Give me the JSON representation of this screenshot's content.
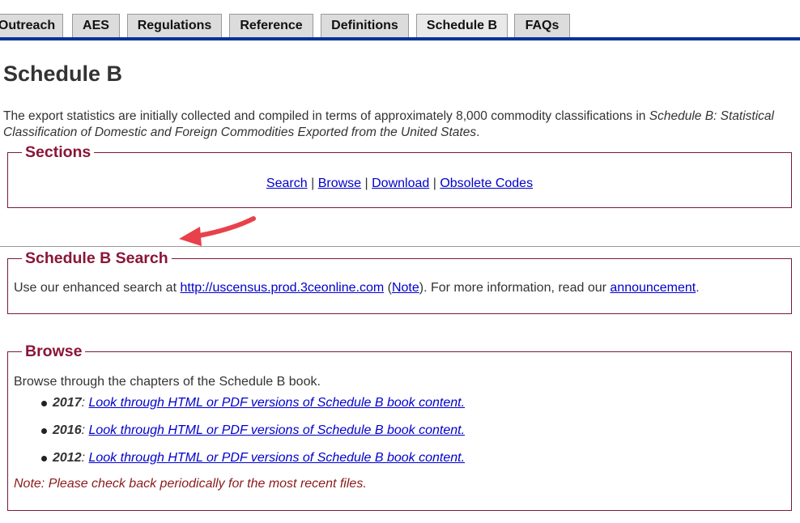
{
  "tabs": [
    {
      "label": "Outreach"
    },
    {
      "label": "AES"
    },
    {
      "label": "Regulations"
    },
    {
      "label": "Reference"
    },
    {
      "label": "Definitions"
    },
    {
      "label": "Schedule B"
    },
    {
      "label": "FAQs"
    }
  ],
  "page": {
    "title": "Schedule B",
    "intro_prefix": "The export statistics are initially collected and compiled in terms of approximately 8,000 commodity classifications in ",
    "intro_italic": "Schedule B: Statistical Classification of Domestic and Foreign Commodities Exported from the United States",
    "intro_suffix": "."
  },
  "sections": {
    "legend": "Sections",
    "links": [
      "Search",
      "Browse",
      "Download",
      "Obsolete Codes"
    ],
    "separator": "|"
  },
  "search": {
    "legend": "Schedule B Search",
    "prefix": "Use our enhanced search at ",
    "url_link": "http://uscensus.prod.3ceonline.com",
    "open_paren": " (",
    "note_link": "Note",
    "middle": "). For more information, read our ",
    "announcement_link": "announcement",
    "end": "."
  },
  "browse": {
    "legend": "Browse",
    "text": "Browse through the chapters of the Schedule B book.",
    "items": [
      {
        "year": "2017",
        "sep": ": ",
        "link": "Look through HTML or PDF versions of Schedule B book content."
      },
      {
        "year": "2016",
        "sep": ": ",
        "link": "Look through HTML or PDF versions of Schedule B book content."
      },
      {
        "year": "2012",
        "sep": ": ",
        "link": "Look through HTML or PDF versions of Schedule B book content."
      }
    ],
    "note": "Note: Please check back periodically for the most recent files."
  },
  "colors": {
    "tab_line": "#003399",
    "legend": "#8b1538",
    "link": "#0000cc",
    "note": "#8b1a1a",
    "arrow": "#e8414a"
  }
}
